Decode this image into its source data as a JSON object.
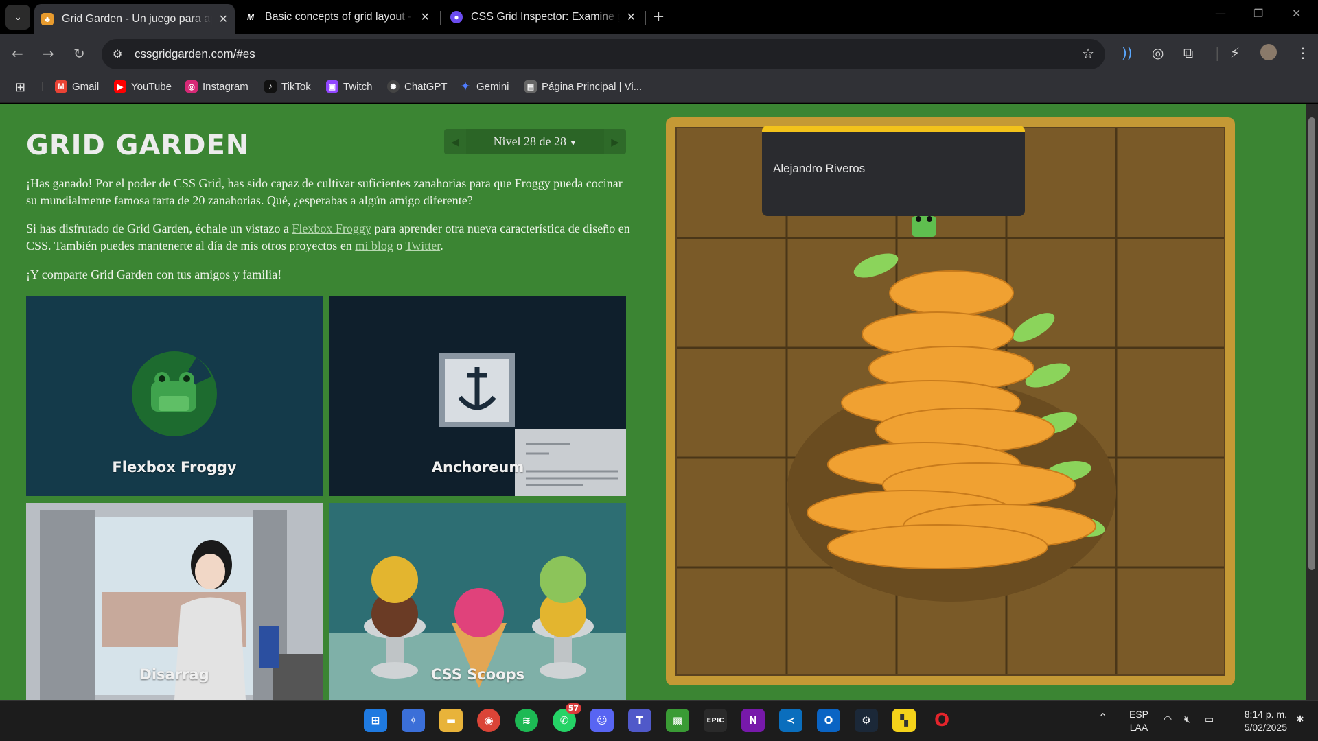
{
  "browser": {
    "tabs": [
      {
        "title": "Grid Garden - Un juego para ap",
        "icon": "carrot-icon",
        "active": true
      },
      {
        "title": "Basic concepts of grid layout - C",
        "icon": "mdn-icon",
        "active": false
      },
      {
        "title": "CSS Grid Inspector: Examine gri",
        "icon": "firefox-icon",
        "active": false
      }
    ],
    "url": "cssgridgarden.com/#es",
    "bookmarks": [
      {
        "label": "Gmail",
        "icon": "gmail-icon",
        "color": "#ea4335"
      },
      {
        "label": "YouTube",
        "icon": "youtube-icon",
        "color": "#ff0000"
      },
      {
        "label": "Instagram",
        "icon": "instagram-icon",
        "color": "#d62976"
      },
      {
        "label": "TikTok",
        "icon": "tiktok-icon",
        "color": "#111111"
      },
      {
        "label": "Twitch",
        "icon": "twitch-icon",
        "color": "#9146ff"
      },
      {
        "label": "ChatGPT",
        "icon": "chatgpt-icon",
        "color": "#444444"
      },
      {
        "label": "Gemini",
        "icon": "gemini-icon",
        "color": "#4f7cff"
      },
      {
        "label": "Página Principal | Vi...",
        "icon": "page-icon",
        "color": "#666666"
      }
    ],
    "profile_popup": "Alejandro Riveros"
  },
  "page": {
    "title": "GRID GARDEN",
    "level_label": "Nivel 28 de 28",
    "p1": "¡Has ganado! Por el poder de CSS Grid, has sido capaz de cultivar suficientes zanahorias para que Froggy pueda cocinar su mundialmente famosa tarta de 20 zanahorias. Qué, ¿esperabas a algún amigo diferente?",
    "p2_a": "Si has disfrutado de Grid Garden, échale un vistazo a ",
    "p2_link1": "Flexbox Froggy",
    "p2_b": " para aprender otra nueva característica de diseño en CSS. También puedes mantenerte al día de mis otros proyectos en ",
    "p2_link2": "mi blog",
    "p2_c": " o ",
    "p2_link3": "Twitter",
    "p2_d": ".",
    "p3": "¡Y comparte Grid Garden con tus amigos y familia!",
    "cards": [
      {
        "label": "Flexbox Froggy",
        "color": "#143a4a"
      },
      {
        "label": "Anchoreum",
        "color": "#0f1f2c"
      },
      {
        "label": "Disarrag",
        "color": "#9aa0a8"
      },
      {
        "label": "CSS Scoops",
        "color": "#2d6e73"
      }
    ]
  },
  "taskbar": {
    "whatsapp_badge": "57",
    "lang1": "ESP",
    "lang2": "LAA",
    "time": "8:14 p. m.",
    "date": "5/02/2025"
  },
  "colors": {
    "garden_bg": "#3b8533",
    "carrot": "#f0a132",
    "leaf": "#8bd45b"
  }
}
